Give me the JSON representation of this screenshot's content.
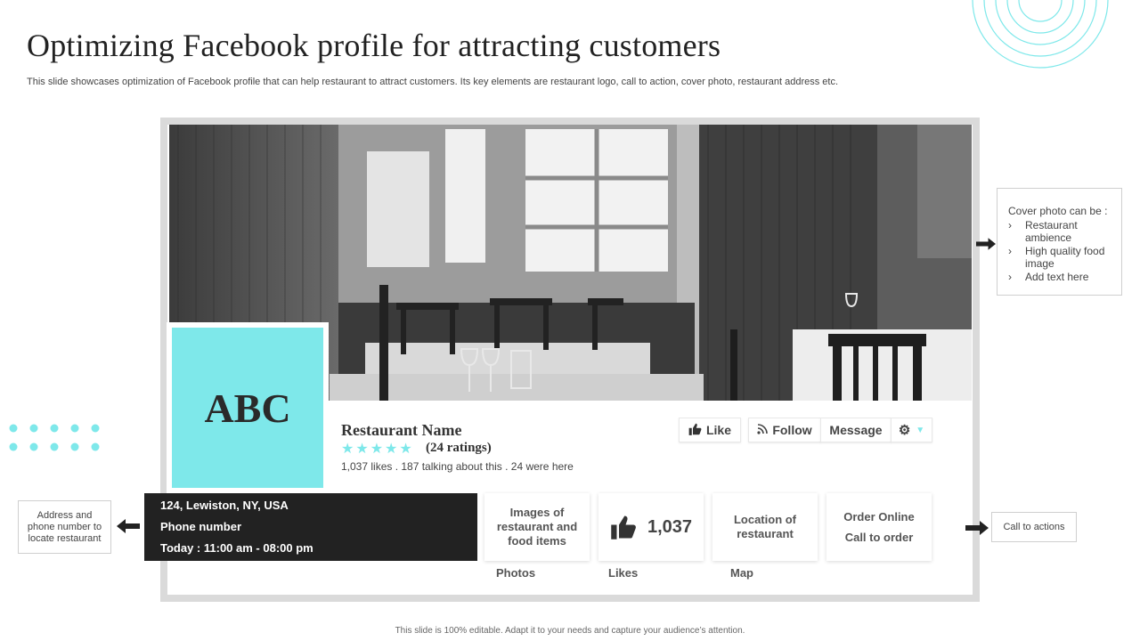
{
  "slide": {
    "title": "Optimizing Facebook profile for attracting customers",
    "subtitle": "This slide showcases optimization of Facebook profile that can help restaurant to attract customers. Its key elements are restaurant logo, call to action, cover photo, restaurant address etc.",
    "footer": "This slide is 100% editable. Adapt it to your needs and capture your audience’s attention."
  },
  "profile": {
    "logo_text": "ABC",
    "name": "Restaurant Name",
    "stars": "★★★★★",
    "ratings": "(24 ratings)",
    "stats": "1,037 likes . 187 talking about this . 24 were here",
    "buttons": {
      "like": "Like",
      "follow": "Follow",
      "message": "Message"
    },
    "address_lines": [
      "124, Lewiston, NY, USA",
      "Phone number",
      "Today : 11:00 am - 08:00 pm"
    ],
    "cards": {
      "images": "Images of restaurant and food items",
      "likes_count": "1,037",
      "location": "Location of restaurant",
      "order_online": "Order Online",
      "call_to_order": "Call to order"
    },
    "tabs": [
      "Photos",
      "Likes",
      "Map"
    ]
  },
  "callouts": {
    "address": "Address and phone number to locate restaurant",
    "call_to_actions": "Call to actions",
    "cover_heading": "Cover photo can be :",
    "cover_items": [
      "Restaurant ambience",
      "High quality food image",
      "Add text here"
    ]
  },
  "colors": {
    "accent": "#7ee8ea",
    "dark": "#222222",
    "frame": "#dadada"
  },
  "icons": {
    "like": "thumbs-up-icon",
    "follow": "rss-icon",
    "settings": "gear-icon",
    "arrow": "arrow-icon"
  }
}
